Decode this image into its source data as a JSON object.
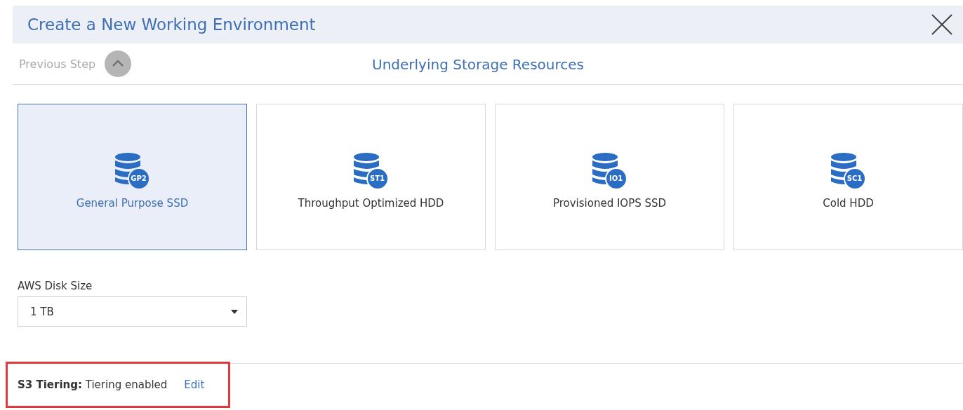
{
  "window": {
    "title": "Create a New Working Environment"
  },
  "step": {
    "previous_label": "Previous Step",
    "title": "Underlying Storage Resources"
  },
  "disk_types": [
    {
      "badge": "GP2",
      "label": "General Purpose SSD",
      "selected": true
    },
    {
      "badge": "ST1",
      "label": "Throughput Optimized HDD",
      "selected": false
    },
    {
      "badge": "IO1",
      "label": "Provisioned IOPS SSD",
      "selected": false
    },
    {
      "badge": "SC1",
      "label": "Cold HDD",
      "selected": false
    }
  ],
  "disk_size": {
    "label": "AWS Disk Size",
    "value": "1 TB"
  },
  "tiering": {
    "text": "**S3 Tiering:** Tiering enabled",
    "link": "Edit",
    "highlighted": true
  }
}
